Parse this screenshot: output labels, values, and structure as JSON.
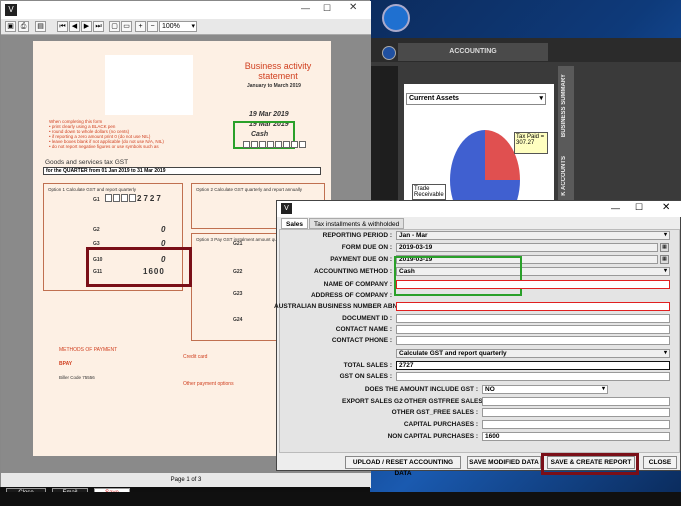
{
  "pdf": {
    "zoom": "100%",
    "page_status": "Page 1 of 3",
    "bottom_close": "Close",
    "bottom_email": "Email",
    "bottom_save": "Save",
    "title": "Business activity statement",
    "period_sub": "January to March 2019",
    "form_due": "19 Mar 2019",
    "payment_due": "19 Mar 2019",
    "method": "Cash",
    "gst_heading": "Goods and services tax GST",
    "quarter": "for the QUARTER from 01 Jan 2019 to 31 Mar 2019",
    "g1_value": "2727",
    "g10_value": "1600",
    "g_zero": "0",
    "option1": "Option 1 Calculate GST and report quarterly",
    "option2": "Option 2 Calculate GST quarterly and report annually",
    "option3": "Option 3 Pay GST instalment amount quarterly",
    "methods": "METHODS OF PAYMENT",
    "credit_card": "Credit card",
    "other_options": "Other payment options",
    "bpay": "BPAY",
    "biller": "Biller Code 75556",
    "intro_lines": [
      "When completing this form",
      "• print clearly using a BLACK pen",
      "• round down to whole dollars (no cents)",
      "• if reporting a zero amount print 0 (do not use NIL)",
      "• leave boxes blank if not applicable (do not use N/A, NIL)",
      "• do not report negative figures or use symbols such as"
    ],
    "left_labels": [
      "G1",
      "G2",
      "G3",
      "G10",
      "G11"
    ],
    "mid_labels": [
      "G21",
      "G22",
      "G23",
      "G24"
    ]
  },
  "bg_app": {
    "tab": "ACCOUNTING",
    "select": "Current Assets",
    "tax_paid": "Tax Paid = 307.27",
    "trade": "Trade Receivable",
    "side_tab_1": "BUSINESS SUMMARY",
    "side_tab_2": "K ACCOUNTS"
  },
  "dialog": {
    "tabs": [
      "Sales",
      "Tax installments & withholded"
    ],
    "fields": {
      "reporting_period_label": "REPORTING PERIOD :",
      "reporting_period": "Jan - Mar",
      "form_due_label": "FORM DUE ON :",
      "form_due": "2019-03-19",
      "payment_due_label": "PAYMENT DUE ON :",
      "payment_due": "2019-03-19",
      "method_label": "ACCOUNTING METHOD :",
      "method": "Cash",
      "company_label": "NAME OF COMPANY :",
      "address_label": "ADDRESS OF COMPANY :",
      "abn_label": "AUSTRALIAN BUSINESS NUMBER ABN :",
      "doc_id_label": "DOCUMENT ID :",
      "contact_name_label": "CONTACT NAME :",
      "contact_phone_label": "CONTACT PHONE :",
      "calc_option": "Calculate GST and report quarterly",
      "total_sales_label": "TOTAL SALES :",
      "total_sales": "2727",
      "gst_on_sales_label": "GST ON SALES :",
      "include_gst_label": "DOES THE AMOUNT INCLUDE GST :",
      "include_gst": "NO",
      "export_label": "EXPORT SALES G2",
      "other_gstfree_label": "OTHER GSTFREE SALES G3 :",
      "other_gstfree2_label": "OTHER GST_FREE SALES :",
      "capital_label": "CAPITAL PURCHASES :",
      "non_capital_label": "NON CAPITAL PURCHASES :",
      "non_capital": "1600"
    },
    "buttons": {
      "upload": "UPLOAD / RESET ACCOUNTING DATA",
      "save_modified": "SAVE MODIFIED DATA",
      "save_create": "SAVE & CREATE REPORT",
      "close": "CLOSE"
    }
  },
  "colors": {
    "highlight_green": "#2aa02a",
    "highlight_red": "#7a0f18",
    "required_red": "#e02020"
  }
}
